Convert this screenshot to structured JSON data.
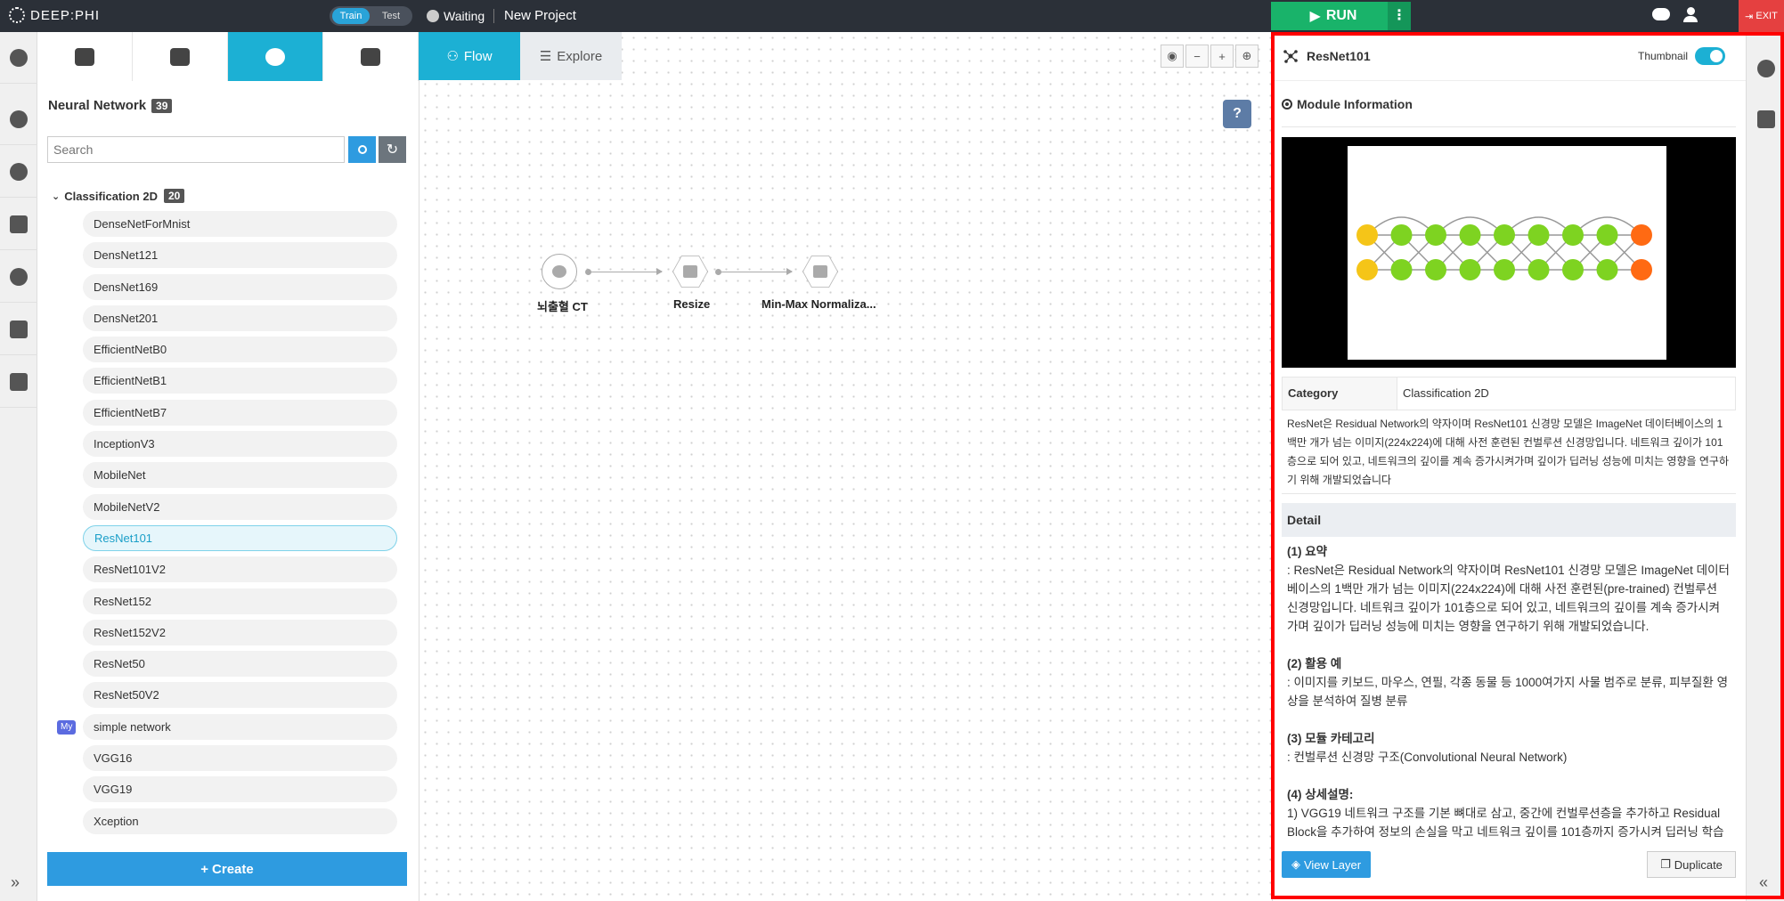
{
  "topbar": {
    "logo": "DEEP:PHI",
    "mode_options": [
      "Train",
      "Test"
    ],
    "status": "Waiting",
    "project": "New Project",
    "run_label": "RUN",
    "run_more": "⋮",
    "exit_label": "EXIT"
  },
  "left_rail_icons": [
    "modules-icon",
    "user-icon",
    "history-icon",
    "upload-icon",
    "info-icon",
    "tools-icon",
    "checklist-icon"
  ],
  "left_tabs": [
    "database-icon",
    "image-icon",
    "network-icon",
    "wrench-icon"
  ],
  "left_panel": {
    "title": "Neural Network",
    "count": "39",
    "search_placeholder": "Search",
    "group": {
      "label": "Classification 2D",
      "count": "20"
    },
    "items": [
      {
        "label": "DenseNetForMnist",
        "tag": ""
      },
      {
        "label": "DensNet121",
        "tag": ""
      },
      {
        "label": "DensNet169",
        "tag": ""
      },
      {
        "label": "DensNet201",
        "tag": ""
      },
      {
        "label": "EfficientNetB0",
        "tag": ""
      },
      {
        "label": "EfficientNetB1",
        "tag": ""
      },
      {
        "label": "EfficientNetB7",
        "tag": ""
      },
      {
        "label": "InceptionV3",
        "tag": ""
      },
      {
        "label": "MobileNet",
        "tag": ""
      },
      {
        "label": "MobileNetV2",
        "tag": ""
      },
      {
        "label": "ResNet101",
        "tag": ""
      },
      {
        "label": "ResNet101V2",
        "tag": ""
      },
      {
        "label": "ResNet152",
        "tag": ""
      },
      {
        "label": "ResNet152V2",
        "tag": ""
      },
      {
        "label": "ResNet50",
        "tag": ""
      },
      {
        "label": "ResNet50V2",
        "tag": ""
      },
      {
        "label": "simple network",
        "tag": "My"
      },
      {
        "label": "VGG16",
        "tag": ""
      },
      {
        "label": "VGG19",
        "tag": ""
      },
      {
        "label": "Xception",
        "tag": ""
      }
    ],
    "selected": "ResNet101",
    "create_label": "Create"
  },
  "canvas": {
    "tabs": [
      "Flow",
      "Explore"
    ],
    "active_tab": "Flow",
    "help": "?",
    "nodes": [
      "뇌출혈 CT",
      "Resize",
      "Min-Max Normaliza..."
    ]
  },
  "right_panel": {
    "title": "ResNet101",
    "thumbnail_label": "Thumbnail",
    "thumbnail_on": true,
    "section": "Module Information",
    "category_key": "Category",
    "category_value": "Classification 2D",
    "description": "ResNet은 Residual Network의 약자이며 ResNet101 신경망 모델은 ImageNet 데이터베이스의 1백만 개가 넘는 이미지(224x224)에 대해 사전 훈련된 컨벌루션 신경망입니다. 네트워크 깊이가 101층으로 되어 있고, 네트워크의 깊이를 계속 증가시켜가며 깊이가 딥러닝 성능에 미치는 영향을 연구하기 위해 개발되었습니다",
    "detail_header": "Detail",
    "detail": [
      {
        "heading": "(1) 요약",
        "text": ": ResNet은 Residual Network의 약자이며 ResNet101 신경망 모델은 ImageNet 데이터베이스의 1백만 개가 넘는 이미지(224x224)에 대해 사전 훈련된(pre-trained) 컨벌루션 신경망입니다. 네트워크 깊이가 101층으로 되어 있고, 네트워크의 깊이를 계속 증가시켜가며 깊이가 딥러닝 성능에 미치는 영향을 연구하기 위해 개발되었습니다."
      },
      {
        "heading": "(2) 활용 예",
        "text": ": 이미지를 키보드, 마우스, 연필, 각종 동물 등 1000여가지 사물 범주로 분류, 피부질환 영상을 분석하여 질병 분류"
      },
      {
        "heading": "(3) 모듈 카테고리",
        "text": ": 컨벌루션 신경망 구조(Convolutional Neural Network)"
      },
      {
        "heading": "(4) 상세설명:",
        "text": "1) VGG19 네트워크 구조를 기본 뼈대로 삼고, 중간에 컨벌루션층을 추가하고 Residual Block을 추가하여 정보의 손실을 막고 네트워크 깊이를 101층까지 증가시켜 딥러닝 학습"
      }
    ],
    "view_layer_label": "View Layer",
    "duplicate_label": "Duplicate"
  },
  "colors": {
    "topbar": "#2b3038",
    "accent": "#1cb0d4",
    "run": "#19b36a",
    "exit": "#e54040",
    "primary_btn": "#2e9be0",
    "highlight_frame": "#ff0000",
    "node_input": "#f5c518",
    "node_hidden": "#7ed321",
    "node_output": "#ff6a13"
  }
}
